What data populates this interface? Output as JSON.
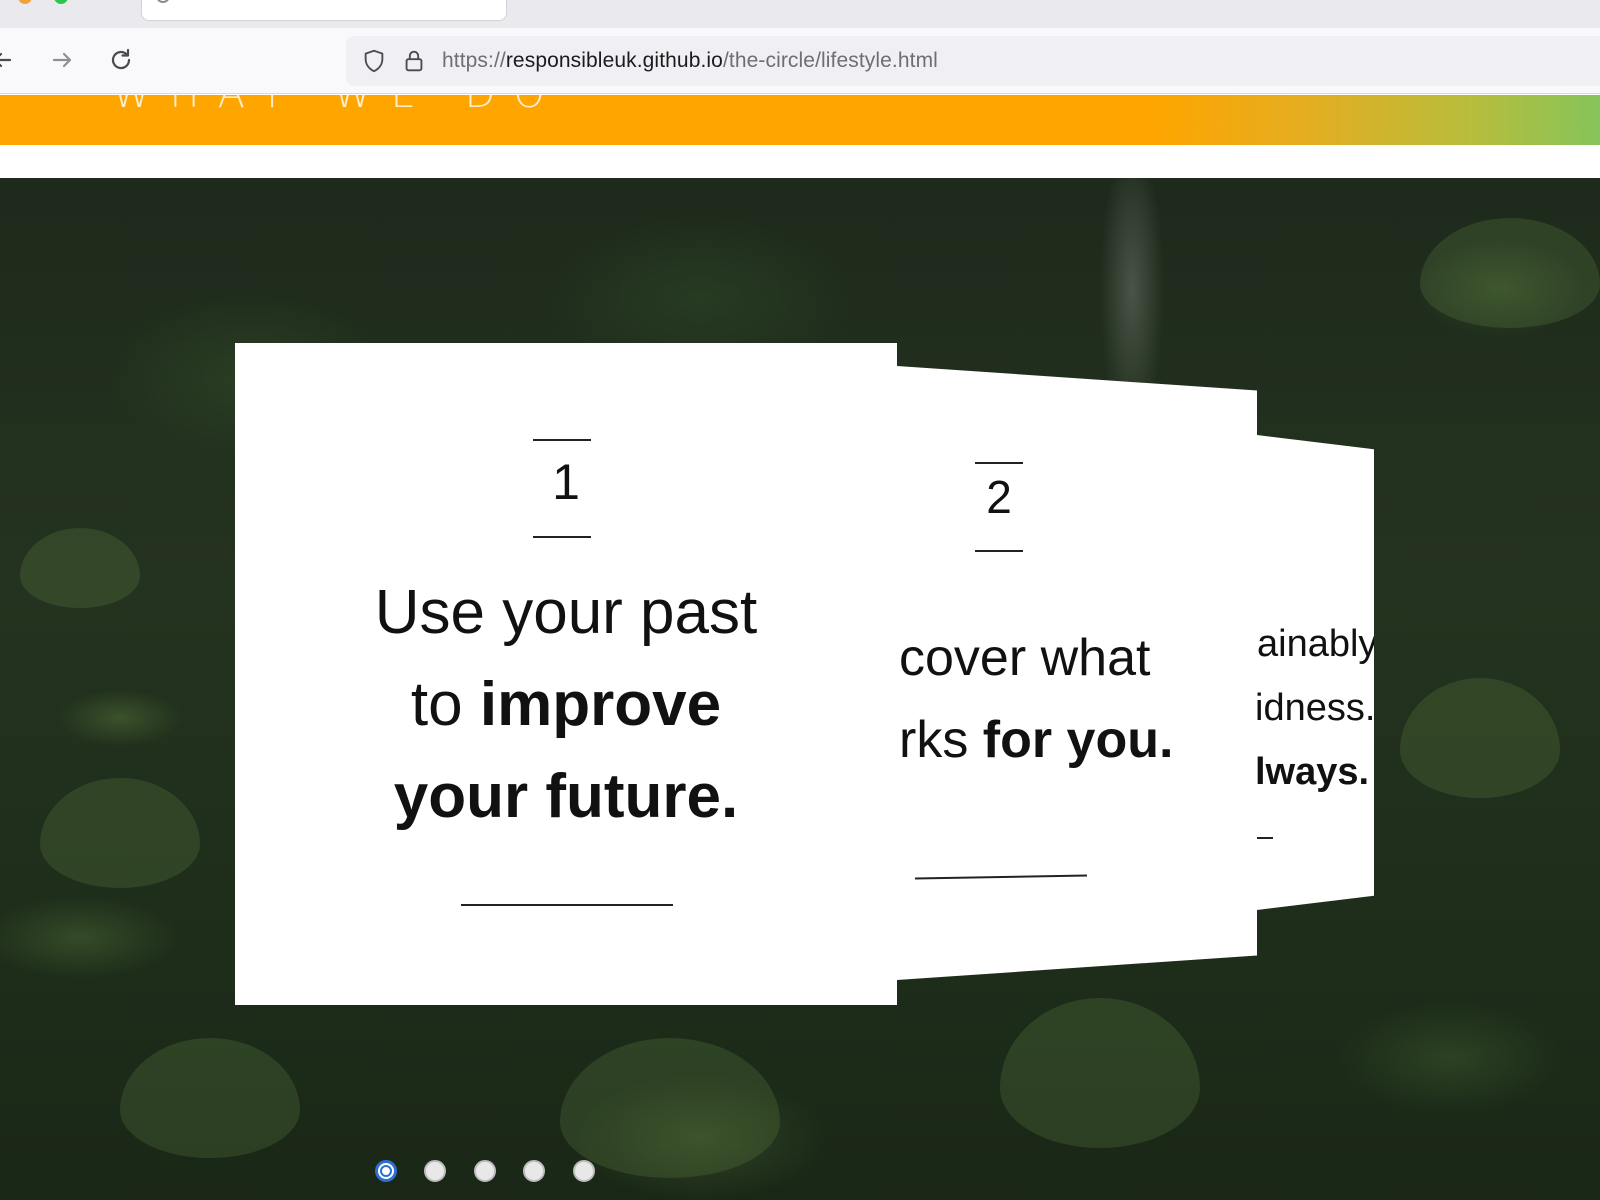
{
  "browser": {
    "tab_title": "",
    "url": {
      "scheme": "https://",
      "host": "responsibleuk.github.io",
      "path": "/the-circle/lifestyle.html"
    }
  },
  "page": {
    "header_nav_title": "WHAT WE DO",
    "colors": {
      "header_orange": "#ffa500",
      "header_green": "#86c45a",
      "active_dot": "#2d6fd2"
    },
    "carousel": {
      "active_index": 0,
      "total_slides": 5,
      "cards": [
        {
          "number": "1",
          "lines": [
            {
              "light": "Use your past",
              "bold": ""
            },
            {
              "light": "to ",
              "bold": "improve"
            },
            {
              "light": "",
              "bold": "your future."
            }
          ]
        },
        {
          "number": "2",
          "lines": [
            {
              "light": "cover what",
              "bold": ""
            },
            {
              "light": "rks ",
              "bold": "for you."
            }
          ]
        },
        {
          "number": "",
          "lines": [
            {
              "light": "ainably",
              "bold": ""
            },
            {
              "light": "idness.",
              "bold": ""
            },
            {
              "light": "",
              "bold": "lways."
            }
          ]
        }
      ]
    }
  }
}
